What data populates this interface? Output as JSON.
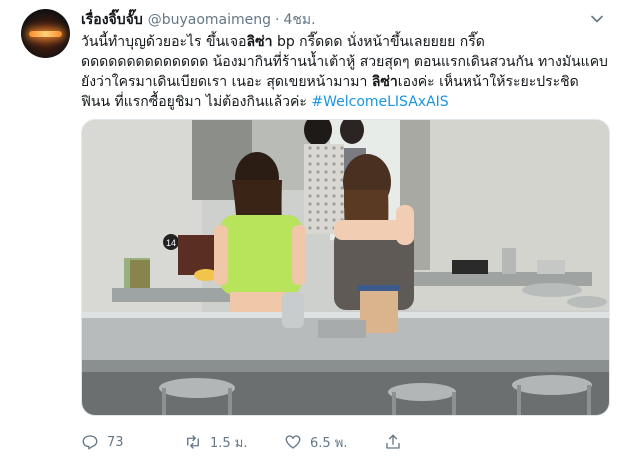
{
  "user": {
    "display_name": "เรื่องจิ๊บจั๊บ",
    "handle": "@buyaomaimeng",
    "separator": "·",
    "time": "4ชม."
  },
  "tweet": {
    "text_1": "วันนี้ทำบุญด้วยอะไร ขึ้นเจอ",
    "bold_1": "ลิซ่า",
    "text_2": " bp กรี๊ดดด นั่งหน้าขึ้นเลยยยย กรี๊ดดดดดดดดดดดดดดด น้องมากินที่ร้านน้ำเต้าหู้ สวยสุดๆ ตอนแรกเดินสวนกัน ทางมันแคบ ยังว่าใครมาเดินเบียดเรา เนอะ สุดเขยหน้ามามา ",
    "bold_2": "ลิซ่า",
    "text_3": "เองค่ะ  เห็นหน้าให้ระยะประชิด ฟินน ที่แรกซื้อยูชิมา ไม่ต้องกินแล้วค่ะ ",
    "hashtag": "#WelcomeLISAxAIS"
  },
  "media": {
    "sign_number": "14"
  },
  "actions": {
    "reply_count": "73",
    "retweet_count": "1.5 ม.",
    "like_count": "6.5 พ."
  },
  "icons": {
    "caret": "chevron-down-icon",
    "reply": "reply-icon",
    "retweet": "retweet-icon",
    "like": "heart-icon",
    "share": "share-icon"
  },
  "colors": {
    "text": "#14171a",
    "secondary": "#657786",
    "link": "#1b95e0"
  }
}
